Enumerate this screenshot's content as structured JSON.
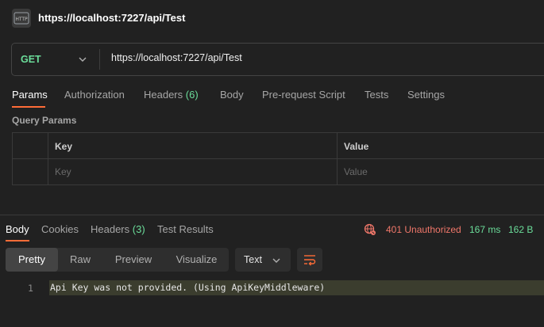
{
  "header": {
    "icon": "http-request-icon",
    "title": "https://localhost:7227/api/Test"
  },
  "urlbar": {
    "method": "GET",
    "url": "https://localhost:7227/api/Test"
  },
  "request_tabs": {
    "params": "Params",
    "authorization": "Authorization",
    "headers": "Headers",
    "headers_count": "(6)",
    "body": "Body",
    "pre_request": "Pre-request Script",
    "tests": "Tests",
    "settings": "Settings"
  },
  "query_params": {
    "label": "Query Params",
    "columns": {
      "key": "Key",
      "value": "Value"
    },
    "placeholders": {
      "key": "Key",
      "value": "Value"
    }
  },
  "response": {
    "tabs": {
      "body": "Body",
      "cookies": "Cookies",
      "headers": "Headers",
      "headers_count": "(3)",
      "test_results": "Test Results"
    },
    "status": "401 Unauthorized",
    "time": "167 ms",
    "size": "162 B",
    "views": [
      "Pretty",
      "Raw",
      "Preview",
      "Visualize"
    ],
    "active_view": "Pretty",
    "format": "Text",
    "lines": [
      {
        "number": "1",
        "text": "Api Key was not provided. (Using ApiKeyMiddleware)"
      }
    ]
  },
  "colors": {
    "accent": "#ff6c37",
    "success": "#6bdd9a",
    "error": "#f0776a",
    "background": "#212121"
  }
}
